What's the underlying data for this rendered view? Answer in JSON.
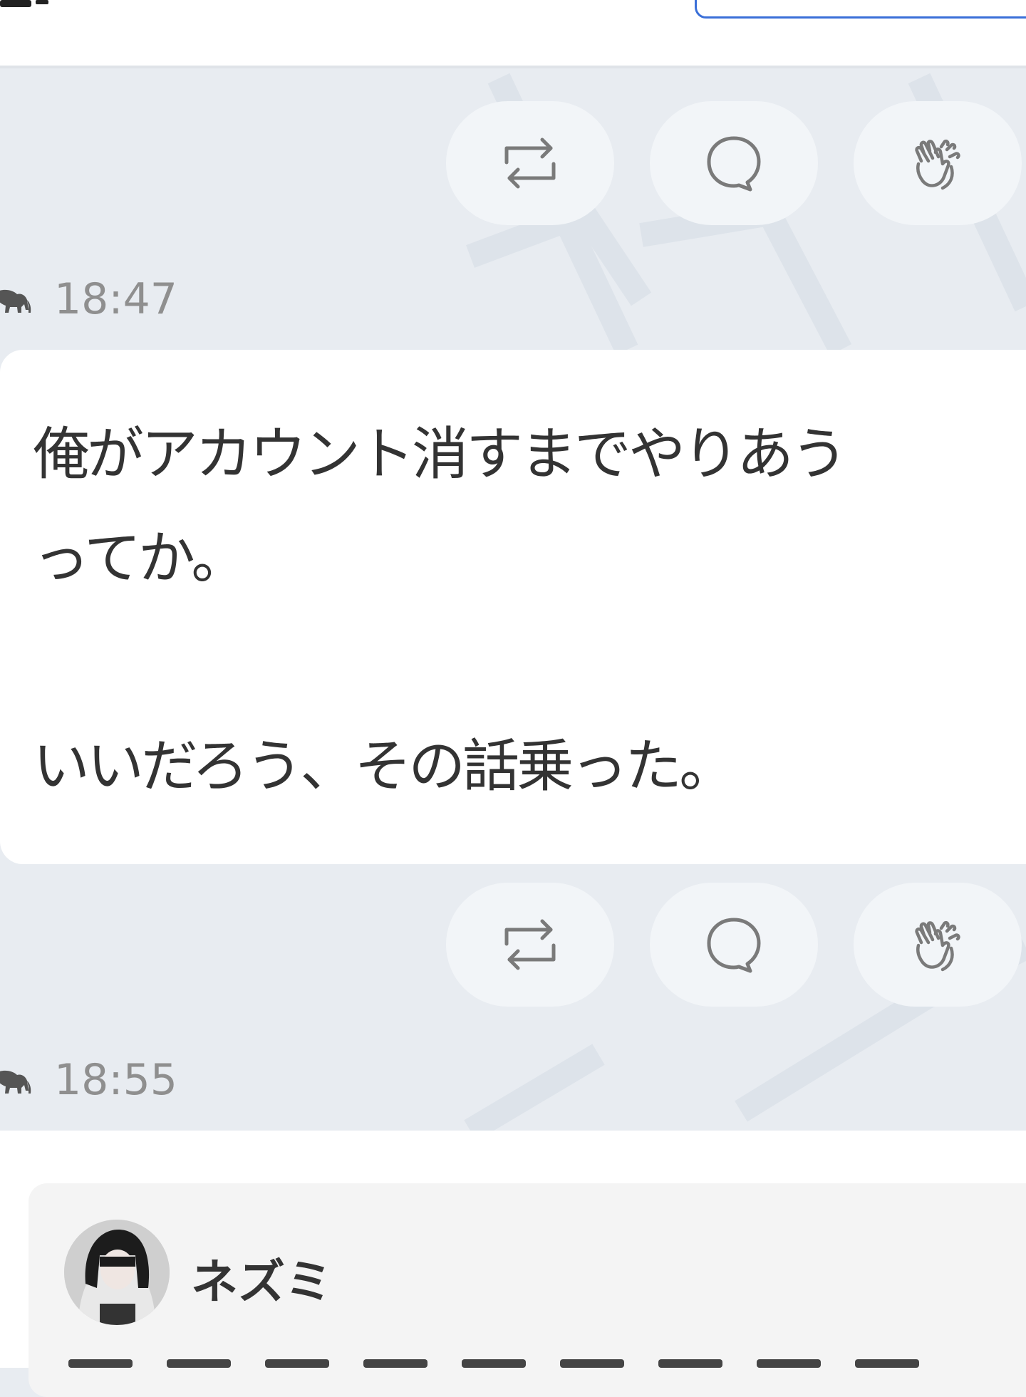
{
  "colors": {
    "background": "#e8ecf1",
    "card": "#ffffff",
    "action_button": "#f2f5f8",
    "icon": "#7a7a7a",
    "timestamp": "#8f8f8f",
    "text": "#333333",
    "search_border": "#3a6fd8",
    "quote_card": "#f4f4f4"
  },
  "timeline": {
    "items": [
      {
        "actions": [
          {
            "name": "repost",
            "icon": "repost-icon"
          },
          {
            "name": "reply",
            "icon": "speech-bubble-icon"
          },
          {
            "name": "clap",
            "icon": "clapping-hands-icon"
          }
        ],
        "timestamp": "18:47",
        "avatar_icon": "elephant-icon"
      },
      {
        "post": {
          "lines": [
            "俺がアカウント消すまでやりあう",
            "ってか。",
            "いいだろう、その話乗った。"
          ]
        },
        "actions": [
          {
            "name": "repost",
            "icon": "repost-icon"
          },
          {
            "name": "reply",
            "icon": "speech-bubble-icon"
          },
          {
            "name": "clap",
            "icon": "clapping-hands-icon"
          }
        ],
        "timestamp": "18:55",
        "avatar_icon": "elephant-icon"
      }
    ]
  },
  "quote": {
    "author": "ネズミ",
    "avatar_icon": "profile-photo"
  }
}
